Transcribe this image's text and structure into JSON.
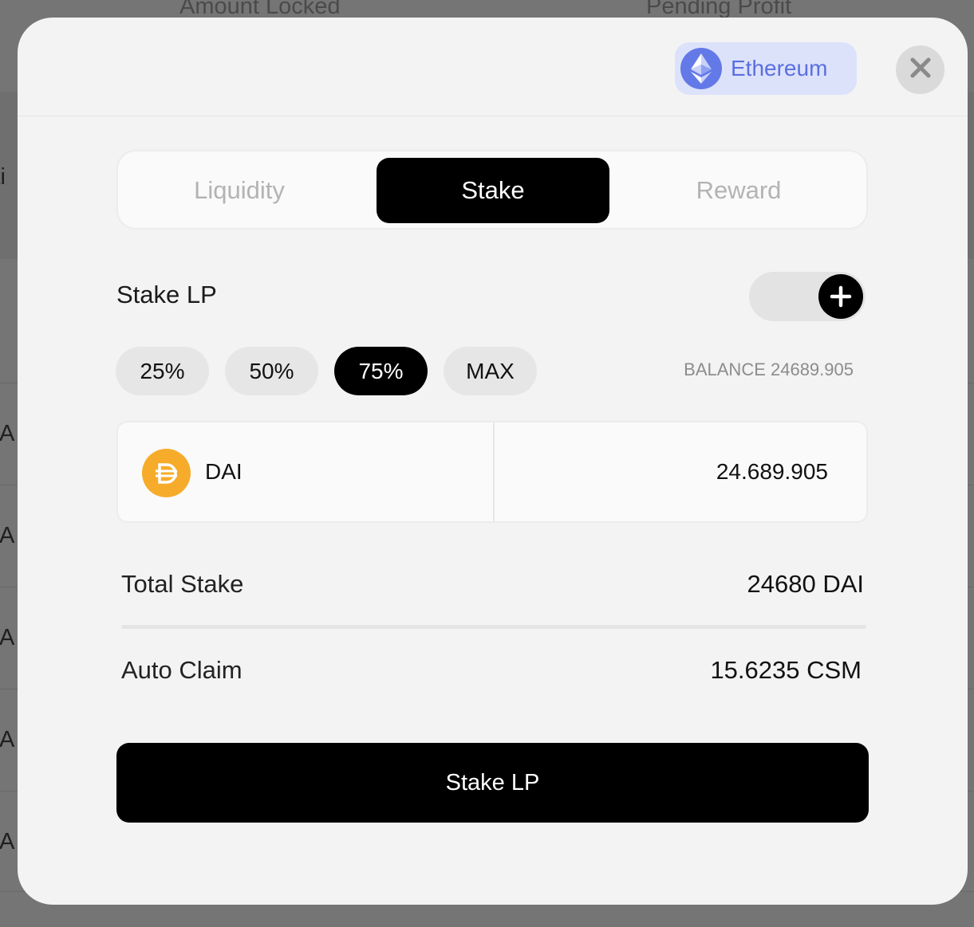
{
  "background": {
    "header_columns": [
      "Amount Locked",
      "Pending Profit"
    ],
    "left_labels": [
      "cti",
      "DA",
      "DA",
      "DA",
      "DA",
      "DA"
    ]
  },
  "modal": {
    "network": {
      "label": "Ethereum",
      "icon": "ethereum-icon"
    },
    "close_icon": "close-icon",
    "tabs": [
      {
        "label": "Liquidity",
        "active": false
      },
      {
        "label": "Stake",
        "active": true
      },
      {
        "label": "Reward",
        "active": false
      }
    ],
    "section_title": "Stake LP",
    "toggle_icon": "plus-icon",
    "percent_options": [
      "25%",
      "50%",
      "75%",
      "MAX"
    ],
    "selected_percent": "75%",
    "balance_label": "BALANCE 24689.905",
    "token": {
      "symbol": "DAI",
      "icon": "dai-icon"
    },
    "amount_value": "24.689.905",
    "summary": {
      "total_stake_label": "Total Stake",
      "total_stake_value": "24680 DAI",
      "auto_claim_label": "Auto Claim",
      "auto_claim_value": "15.6235 CSM"
    },
    "submit_label": "Stake LP"
  },
  "colors": {
    "accent": "#000000",
    "network_pill_bg": "#dde2fb",
    "network_text": "#5a6fe0",
    "dai": "#f6ac2a"
  }
}
